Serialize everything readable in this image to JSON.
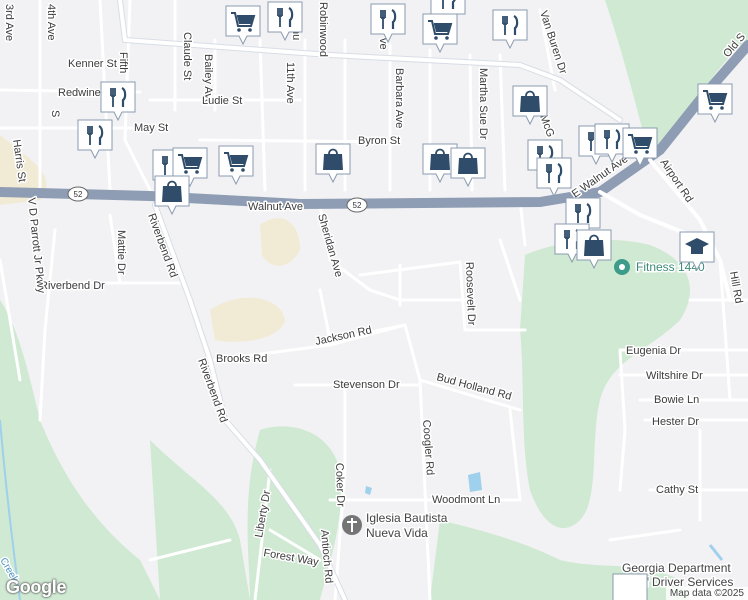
{
  "roads": {
    "walnut_ave": "Walnut Ave",
    "e_walnut_ave": "E Walnut Ave",
    "hwy_52": "52",
    "riverbend_rd": "Riverbend Rd",
    "sheridan_ave": "Sheridan Ave",
    "jackson_rd": "Jackson Rd",
    "brooks_rd": "Brooks Rd",
    "stevenson_dr": "Stevenson Dr",
    "bud_holland_rd": "Bud Holland Rd",
    "coogler_rd": "Coogler Rd",
    "woodmont_ln": "Woodmont Ln",
    "coker_dr": "Coker Dr",
    "antioch_rd": "Antioch Rd",
    "forest_way": "Forest Way",
    "liberty_dr": "Liberty Dr",
    "riverbend_dr": "Riverbend Dr",
    "roosevelt_dr": "Roosevelt Dr",
    "eugenia_dr": "Eugenia Dr",
    "wiltshire_dr": "Wiltshire Dr",
    "bowie_ln": "Bowie Ln",
    "hester_dr": "Hester Dr",
    "cathy_st": "Cathy St",
    "airport_rd": "Airport Rd",
    "hill_rd": "Hill Rd",
    "byron_st": "Byron St",
    "barbara_ave": "Barbara Ave",
    "martha_sue_dr": "Martha Sue Dr",
    "van_buren_dr": "Van Buren Dr",
    "robinwood": "Robinwood",
    "pinehu": "Pinehu",
    "eleventh_ave": "11th Ave",
    "claude_st": "Claude St",
    "bailey_ave": "Bailey Ave",
    "ludie_st": "Ludie St",
    "may_st": "May St",
    "kenner_st": "Kenner St",
    "redwine": "Redwine",
    "fifth": "Fifth",
    "mattie_dr": "Mattie Dr",
    "harris_st": "Harris St",
    "vd_parrott": "V D Parrott Jr Pkwy",
    "fourth_ave": "4th Ave",
    "third_ave": "3rd Ave",
    "mcg": "McG",
    "old_s": "Old S",
    "ave_fragment": "ve",
    "s_fragment": "S",
    "creek": "Creek"
  },
  "places": {
    "fitness": "Fitness 1440",
    "church_line1": "Iglesia Bautista",
    "church_line2": "Nueva Vida",
    "georgia_line1": "Georgia Department",
    "georgia_line2": "Of Driver Services"
  },
  "pin_icons": [
    "restaurant-icon",
    "shopping-bag-icon",
    "shopping-cart-icon",
    "graduation-cap-icon"
  ],
  "attribution": {
    "logo": "Google",
    "map_data": "Map data ©2025"
  },
  "colors": {
    "background": "#f2f2f4",
    "park": "#cfe9d2",
    "sand": "#f1ead4",
    "highway": "#8e9db3",
    "road": "#ffffff",
    "pin": "#ffffff",
    "pin_icon": "#2f4d6a",
    "water": "#9fd0ec"
  }
}
